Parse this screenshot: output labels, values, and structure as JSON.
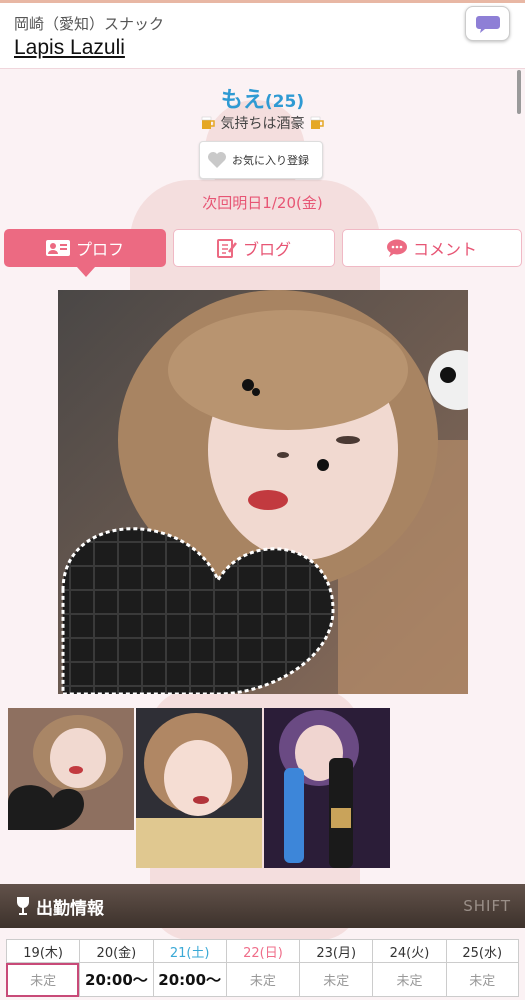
{
  "header": {
    "area": "岡崎（愛知）スナック",
    "shop_name": "Lapis Lazuli"
  },
  "profile": {
    "name": "もえ",
    "age": "(25)",
    "catch_copy": "気持ちは酒豪",
    "favorite_label": "お気に入り登録",
    "next_shift": "次回明日1/20(金)"
  },
  "tabs": [
    {
      "label": "プロフ",
      "icon": "profile-card-icon",
      "active": true
    },
    {
      "label": "ブログ",
      "icon": "edit-note-icon",
      "active": false
    },
    {
      "label": "コメント",
      "icon": "speech-bubble-icon",
      "active": false
    }
  ],
  "shift_section": {
    "title": "出勤情報",
    "subtitle": "SHIFT"
  },
  "schedule": [
    {
      "day": "19(木)",
      "value": "未定"
    },
    {
      "day": "20(金)",
      "value": "20:00〜"
    },
    {
      "day": "21(土)",
      "value": "20:00〜"
    },
    {
      "day": "22(日)",
      "value": "未定"
    },
    {
      "day": "23(月)",
      "value": "未定"
    },
    {
      "day": "24(火)",
      "value": "未定"
    },
    {
      "day": "25(水)",
      "value": "未定"
    }
  ],
  "colors": {
    "accent_pink": "#ec6a82",
    "name_blue": "#2e9ad3",
    "saturday_blue": "#3aa9d6",
    "sunday_pink": "#ef6e8a"
  }
}
